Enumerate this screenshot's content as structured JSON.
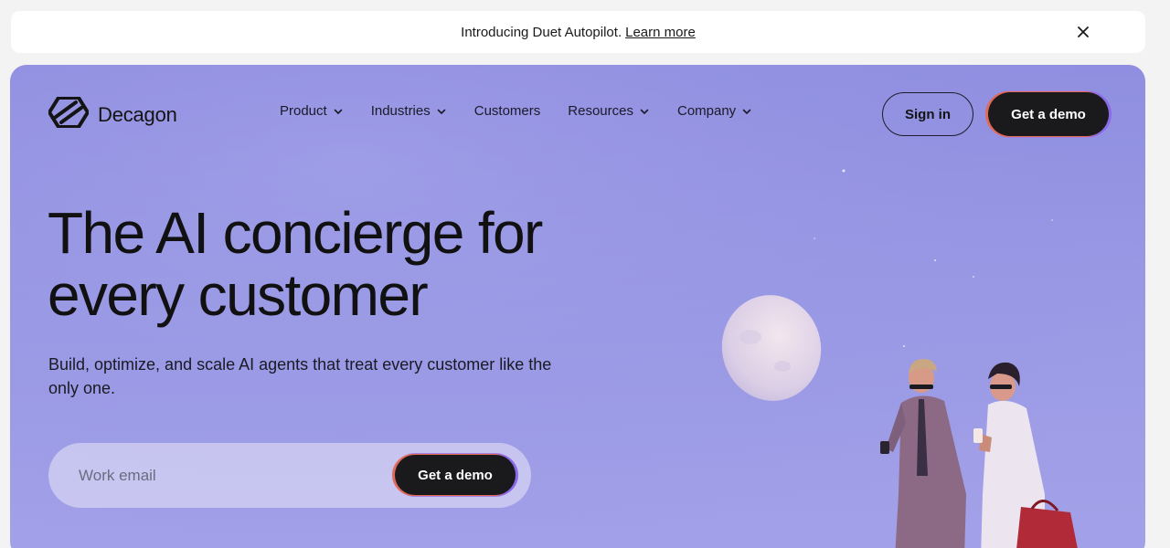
{
  "banner": {
    "text": "Introducing Duet Autopilot.",
    "link": "Learn more",
    "close_icon": "close-icon"
  },
  "brand": {
    "name": "Decagon",
    "logo_icon": "decagon-logo-icon"
  },
  "nav": {
    "items": [
      {
        "label": "Product",
        "has_dropdown": true
      },
      {
        "label": "Industries",
        "has_dropdown": true
      },
      {
        "label": "Customers",
        "has_dropdown": false
      },
      {
        "label": "Resources",
        "has_dropdown": true
      },
      {
        "label": "Company",
        "has_dropdown": true
      }
    ],
    "signin_label": "Sign in",
    "demo_label": "Get a demo"
  },
  "hero": {
    "headline_line1": "The AI concierge for",
    "headline_line2": "every customer",
    "subtitle": "Build, optimize, and scale AI agents that treat every customer like the only one.",
    "email_placeholder": "Work email",
    "email_value": "",
    "cta_label": "Get a demo"
  },
  "colors": {
    "hero_background": "#9797e3",
    "button_dark": "#1a1a1c",
    "button_border_gradient": [
      "#e06a5a",
      "#8a6ae6"
    ]
  }
}
